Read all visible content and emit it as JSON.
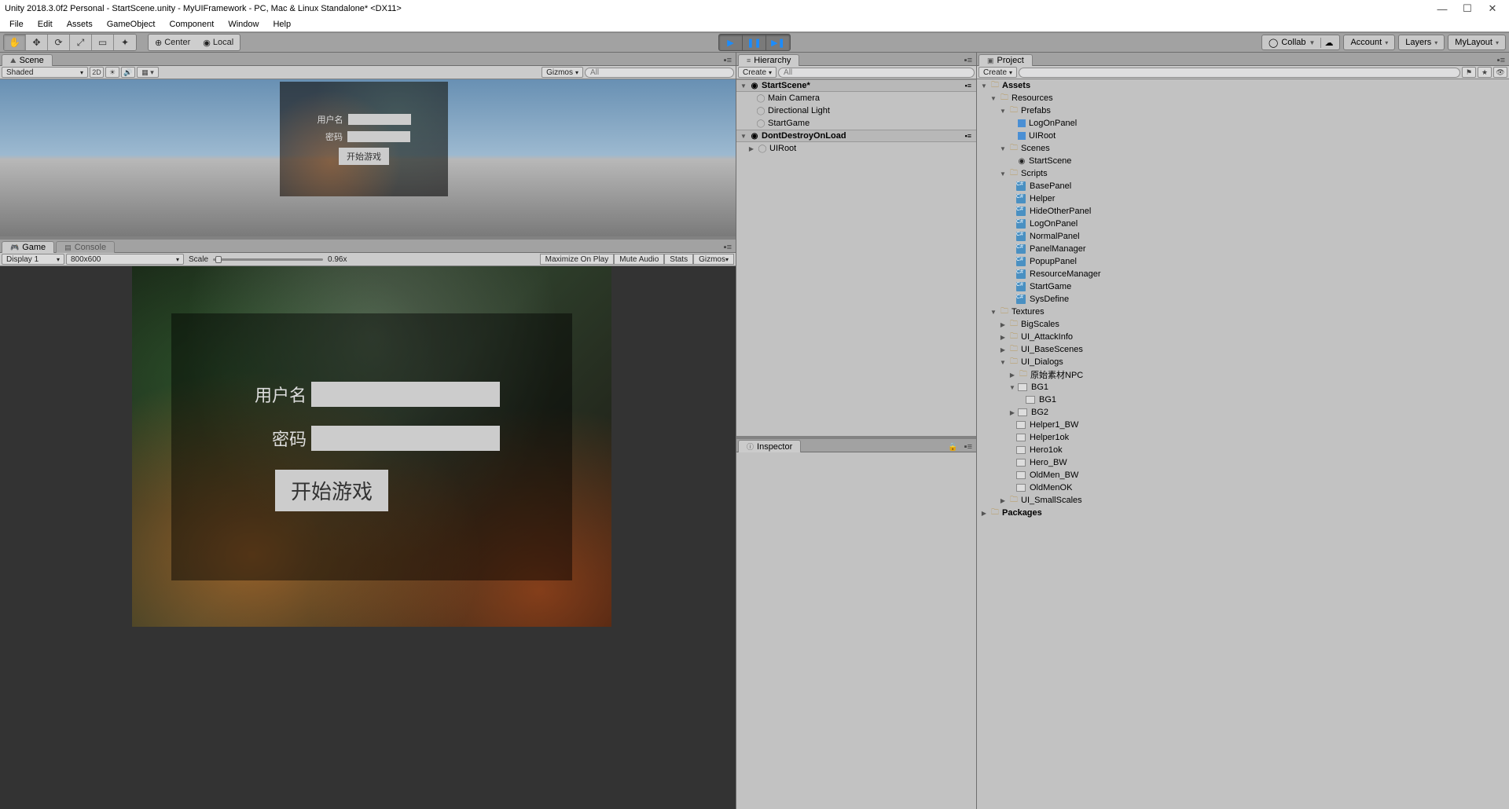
{
  "window": {
    "title": "Unity 2018.3.0f2 Personal - StartScene.unity - MyUIFramework - PC, Mac & Linux Standalone* <DX11>"
  },
  "menubar": [
    "File",
    "Edit",
    "Assets",
    "GameObject",
    "Component",
    "Window",
    "Help"
  ],
  "toolbar": {
    "pivot": "Center",
    "space": "Local",
    "collab": "Collab",
    "account": "Account",
    "layers": "Layers",
    "layout": "MyLayout"
  },
  "sceneTab": "Scene",
  "sceneToolbar": {
    "shading": "Shaded",
    "mode2d": "2D",
    "gizmos": "Gizmos",
    "searchPlaceholder": "All"
  },
  "gameTab": "Game",
  "consoleTab": "Console",
  "gameToolbar": {
    "display": "Display 1",
    "aspect": "800x600",
    "scaleLabel": "Scale",
    "scaleValue": "0.96x",
    "maxOnPlay": "Maximize On Play",
    "muteAudio": "Mute Audio",
    "stats": "Stats",
    "gizmos": "Gizmos"
  },
  "loginPanel": {
    "usernameLabel": "用户名",
    "passwordLabel": "密码",
    "startLabel": "开始游戏"
  },
  "hierarchy": {
    "title": "Hierarchy",
    "create": "Create",
    "searchPlaceholder": "All",
    "scene1": "StartScene*",
    "scene1Items": [
      "Main Camera",
      "Directional Light",
      "StartGame"
    ],
    "scene2": "DontDestroyOnLoad",
    "scene2Items": [
      "UIRoot"
    ]
  },
  "inspector": {
    "title": "Inspector"
  },
  "project": {
    "title": "Project",
    "create": "Create",
    "root": "Assets",
    "resources": "Resources",
    "prefabs": "Prefabs",
    "prefabItems": [
      "LogOnPanel",
      "UIRoot"
    ],
    "scenes": "Scenes",
    "sceneItems": [
      "StartScene"
    ],
    "scripts": "Scripts",
    "scriptItems": [
      "BasePanel",
      "Helper",
      "HideOtherPanel",
      "LogOnPanel",
      "NormalPanel",
      "PanelManager",
      "PopupPanel",
      "ResourceManager",
      "StartGame",
      "SysDefine"
    ],
    "textures": "Textures",
    "textureFolders": [
      "BigScales",
      "UI_AttackInfo",
      "UI_BaseScenes"
    ],
    "uiDialogs": "UI_Dialogs",
    "npcFolder": "原始素材NPC",
    "bg1": "BG1",
    "bg1sub": "BG1",
    "bg2": "BG2",
    "dialogImages": [
      "Helper1_BW",
      "Helper1ok",
      "Hero1ok",
      "Hero_BW",
      "OldMen_BW",
      "OldMenOK"
    ],
    "smallScales": "UI_SmallScales",
    "packages": "Packages"
  }
}
